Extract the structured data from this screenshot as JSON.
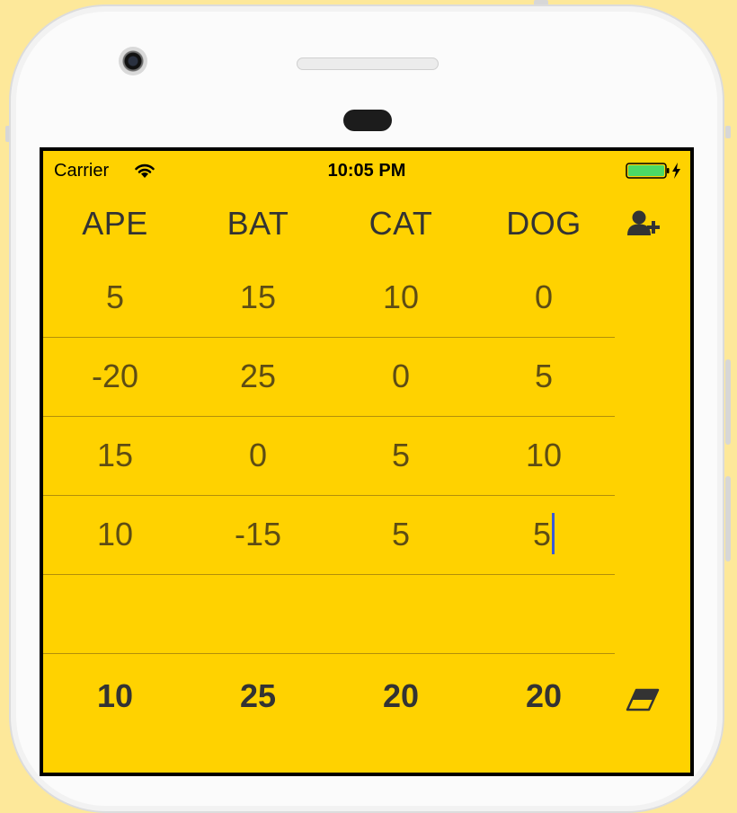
{
  "status_bar": {
    "carrier": "Carrier",
    "time": "10:05 PM",
    "icons": [
      "wifi-icon",
      "battery-icon",
      "charging-bolt-icon"
    ]
  },
  "players": [
    "APE",
    "BAT",
    "CAT",
    "DOG"
  ],
  "rounds": [
    [
      "5",
      "15",
      "10",
      "0"
    ],
    [
      "-20",
      "25",
      "0",
      "5"
    ],
    [
      "15",
      "0",
      "5",
      "10"
    ],
    [
      "10",
      "-15",
      "5",
      "5"
    ],
    [
      "",
      "",
      "",
      ""
    ]
  ],
  "totals": [
    "10",
    "25",
    "20",
    "20"
  ],
  "active_cell": {
    "row": 3,
    "col": 3
  },
  "actions": {
    "add_player": "add-user-icon",
    "clear": "eraser-icon"
  },
  "colors": {
    "background": "#ffd200",
    "text": "#333333",
    "score_text": "#5e4d14",
    "divider": "#b38f0a",
    "cursor": "#3a5ad8",
    "battery": "#4cd964"
  }
}
